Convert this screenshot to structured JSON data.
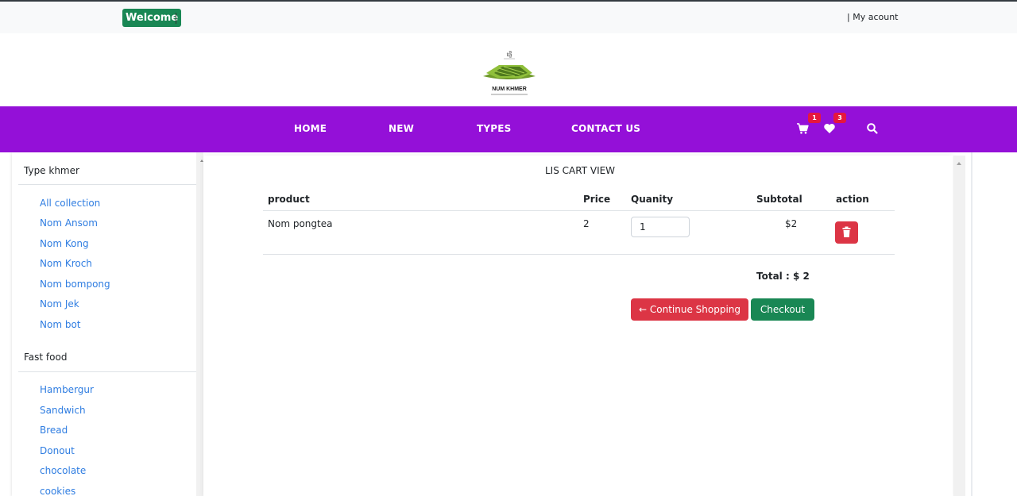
{
  "topbar": {
    "welcome_label": "Welcome",
    "account_label": "| My acount"
  },
  "logo": {
    "script_text": "ផ្ញើ",
    "brand_text": "NUM KHMER"
  },
  "nav": {
    "items": [
      "HOME",
      "NEW",
      "TYPES",
      "CONTACT US"
    ],
    "cart_count": "1",
    "wishlist_count": "3"
  },
  "sidebar": {
    "groups": [
      {
        "heading": "Type khmer",
        "links": [
          "All collection",
          "Nom Ansom",
          "Nom Kong",
          "Nom Kroch",
          "Nom bompong",
          "Nom Jek",
          "Nom bot"
        ]
      },
      {
        "heading": "Fast food",
        "links": [
          "Hambergur",
          "Sandwich",
          "Bread",
          "Donout",
          "chocolate",
          "cookies"
        ]
      }
    ]
  },
  "cart": {
    "title": "LIS CART VIEW",
    "headers": {
      "product": "product",
      "price": "Price",
      "quantity": "Quanity",
      "subtotal": "Subtotal",
      "action": "action"
    },
    "rows": [
      {
        "product": "Nom pongtea",
        "price": "2",
        "quantity": "1",
        "subtotal": "$2"
      }
    ],
    "total": "Total : $ 2",
    "continue_label": "Continue Shopping",
    "checkout_label": "Checkout"
  },
  "colors": {
    "nav_bg": "#9410d8",
    "success": "#198754",
    "danger": "#dc3545",
    "link": "#2f7de1",
    "badge": "#e6173d"
  }
}
